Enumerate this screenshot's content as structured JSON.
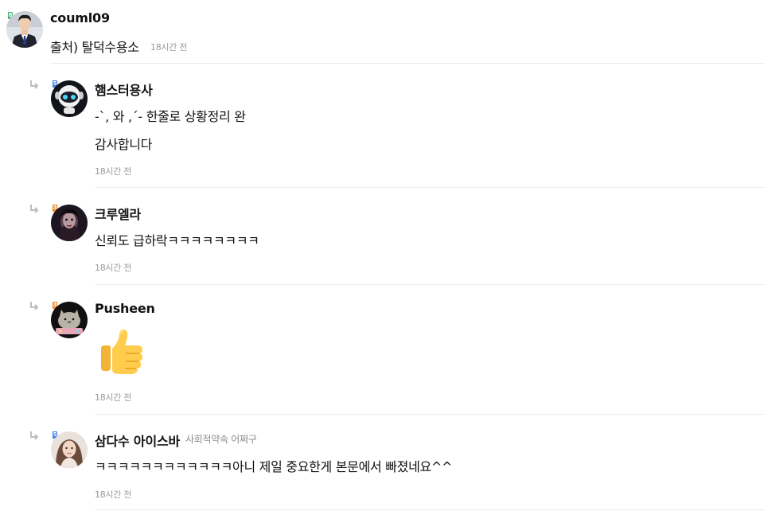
{
  "comments": [
    {
      "author": "couml09",
      "level": "8",
      "lines": [
        "출처) 탈덕수용소"
      ],
      "time": "18시간 전"
    },
    {
      "author": "햄스터용사",
      "level": "5",
      "lines": [
        "-`, 와 ,´- 한줄로 상황정리 완",
        "감사합니다"
      ],
      "time": "18시간 전"
    },
    {
      "author": "크루엘라",
      "level": "3",
      "lines": [
        "신뢰도 급하락ㅋㅋㅋㅋㅋㅋㅋㅋ"
      ],
      "time": "18시간 전"
    },
    {
      "author": "Pusheen",
      "level": "3",
      "emoji": "thumbs-up",
      "time": "18시간 전"
    },
    {
      "author": "삼다수 아이스바",
      "level": "5",
      "author_note": "사회적약속 어쩌구",
      "lines": [
        " ㅋㅋㅋㅋㅋㅋㅋㅋㅋㅋㅋㅋ아니 제일 중요한게 본문에서 빠졌네요^^"
      ],
      "time": "18시간 전"
    }
  ],
  "colors": {
    "level_8": "#4caf7a",
    "level_5": "#3d7be0",
    "level_3": "#f08a2a",
    "divider": "#ececec",
    "muted_text": "#999999"
  }
}
